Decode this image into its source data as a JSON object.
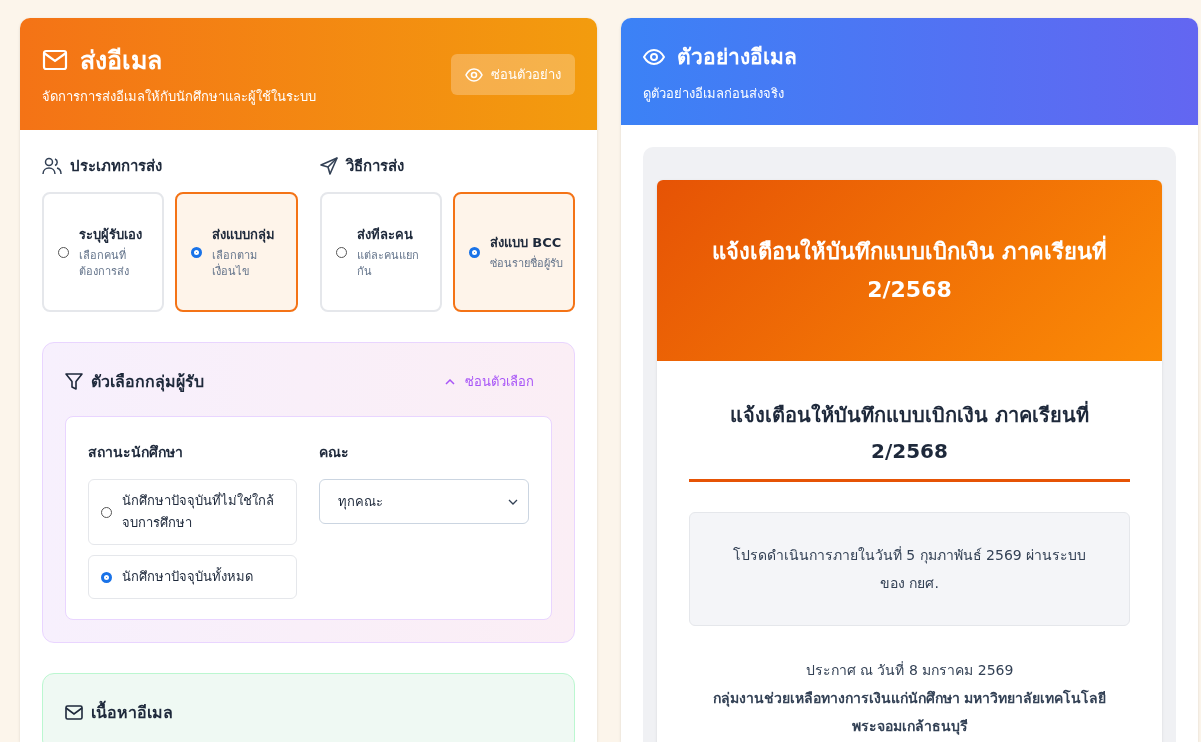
{
  "compose": {
    "title": "ส่งอีเมล",
    "subtitle": "จัดการการส่งอีเมลให้กับนักศึกษาและผู้ใช้ในระบบ",
    "toggle_preview_button": "ซ่อนตัวอย่าง",
    "send_type": {
      "label": "ประเภทการส่ง",
      "options": [
        {
          "title": "ระบุผู้รับเอง",
          "description": "เลือกคนที่ต้องการส่ง",
          "selected": false
        },
        {
          "title": "ส่งแบบกลุ่ม",
          "description": "เลือกตามเงื่อนไข",
          "selected": true
        }
      ]
    },
    "send_method": {
      "label": "วิธีการส่ง",
      "options": [
        {
          "title": "ส่งทีละคน",
          "description": "แต่ละคนแยกกัน",
          "selected": false
        },
        {
          "title": "ส่งแบบ BCC",
          "description": "ซ่อนรายชื่อผู้รับ",
          "selected": true
        }
      ]
    },
    "group_filter": {
      "title": "ตัวเลือกกลุ่มผู้รับ",
      "toggle": "ซ่อนตัวเลือก",
      "expanded": true,
      "status": {
        "label": "สถานะนักศึกษา",
        "options": [
          {
            "label": "นักศึกษาปัจจุบันที่ไม่ใช่ใกล้จบการศึกษา",
            "selected": false
          },
          {
            "label": "นักศึกษาปัจจุบันทั้งหมด",
            "selected": true
          }
        ]
      },
      "faculty": {
        "label": "คณะ",
        "value": "ทุกคณะ"
      }
    },
    "content": {
      "title": "เนื้อหาอีเมล"
    }
  },
  "preview": {
    "title": "ตัวอย่างอีเมล",
    "subtitle": "ดูตัวอย่างอีเมลก่อนส่งจริง",
    "email": {
      "banner_title": "แจ้งเตือนให้บันทึกแบบเบิกเงิน ภาคเรียนที่ 2/2568",
      "heading": "แจ้งเตือนให้บันทึกแบบเบิกเงิน ภาคเรียนที่ 2/2568",
      "notice": "โปรดดำเนินการภายในวันที่ 5 กุมภาพันธ์ 2569 ผ่านระบบของ กยศ.",
      "announced": "ประกาศ ณ วันที่ 8 มกราคม 2569",
      "organization": "กลุ่มงานช่วยเหลือทางการเงินแก่นักศึกษา มหาวิทยาลัยเทคโนโลยีพระจอมเกล้าธนบุรี"
    }
  }
}
